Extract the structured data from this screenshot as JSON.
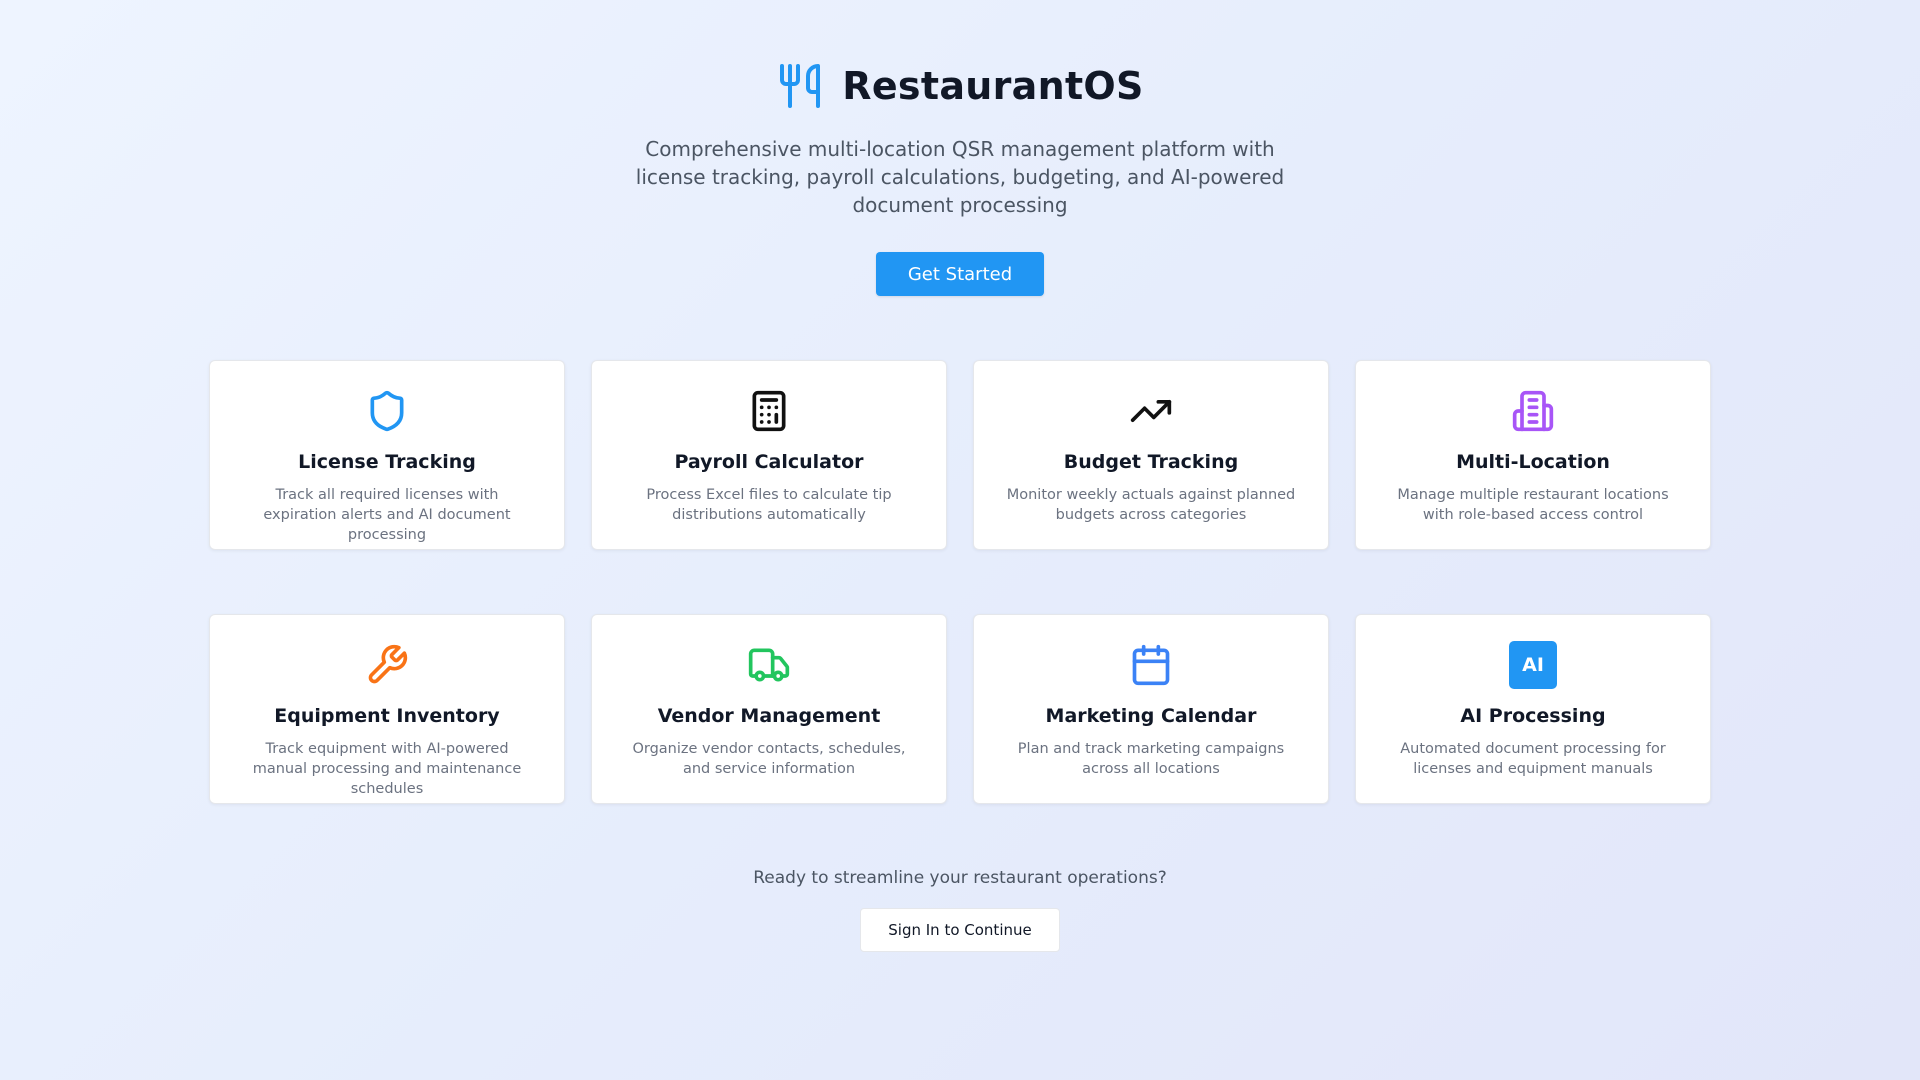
{
  "brand": {
    "title": "RestaurantOS",
    "icon": "utensils-icon",
    "accent": "#2196f3"
  },
  "hero": {
    "tagline": "Comprehensive multi-location QSR management platform with license tracking, payroll calculations, budgeting, and AI-powered document processing",
    "cta_label": "Get Started"
  },
  "features": [
    {
      "title": "License Tracking",
      "description": "Track all required licenses with expiration alerts and AI document processing",
      "icon": "shield-icon",
      "color": "#2196f3"
    },
    {
      "title": "Payroll Calculator",
      "description": "Process Excel files to calculate tip distributions automatically",
      "icon": "calculator-icon",
      "color": "#111111"
    },
    {
      "title": "Budget Tracking",
      "description": "Monitor weekly actuals against planned budgets across categories",
      "icon": "trending-up-icon",
      "color": "#111111"
    },
    {
      "title": "Multi-Location",
      "description": "Manage multiple restaurant locations with role-based access control",
      "icon": "building-icon",
      "color": "#a855f7"
    },
    {
      "title": "Equipment Inventory",
      "description": "Track equipment with AI-powered manual processing and maintenance schedules",
      "icon": "wrench-icon",
      "color": "#f97316"
    },
    {
      "title": "Vendor Management",
      "description": "Organize vendor contacts, schedules, and service information",
      "icon": "truck-icon",
      "color": "#22c55e"
    },
    {
      "title": "Marketing Calendar",
      "description": "Plan and track marketing campaigns across all locations",
      "icon": "calendar-icon",
      "color": "#3b82f6"
    },
    {
      "title": "AI Processing",
      "description": "Automated document processing for licenses and equipment manuals",
      "icon": "ai-badge-icon",
      "icon_text": "AI",
      "color": "#2196f3"
    }
  ],
  "footer": {
    "prompt": "Ready to streamline your restaurant operations?",
    "signin_label": "Sign In to Continue"
  }
}
